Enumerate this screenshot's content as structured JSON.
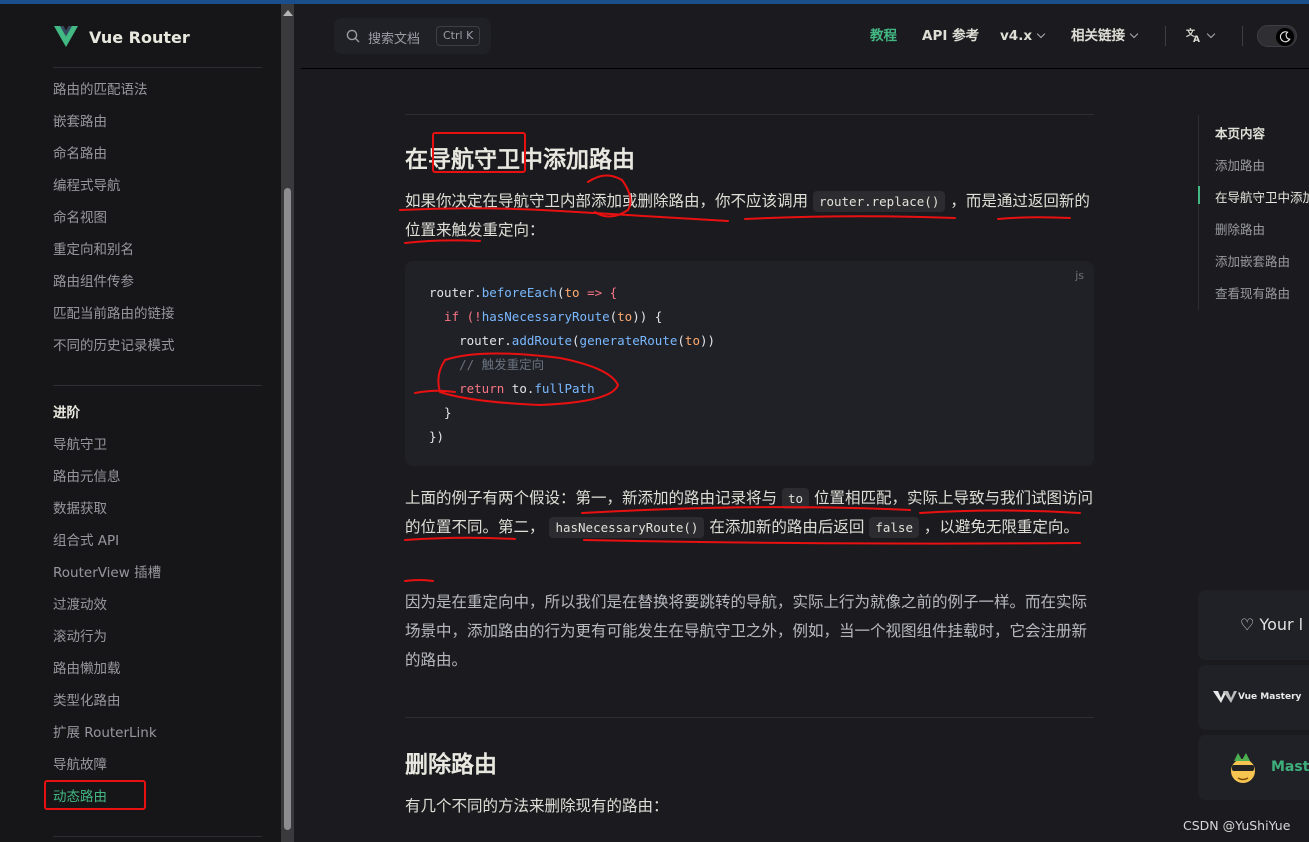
{
  "brand": {
    "title": "Vue Router"
  },
  "sidebar": {
    "items": [
      "路由的匹配语法",
      "嵌套路由",
      "命名路由",
      "编程式导航",
      "命名视图",
      "重定向和别名",
      "路由组件传参",
      "匹配当前路由的链接",
      "不同的历史记录模式"
    ],
    "advanced_heading": "进阶",
    "advanced_items": [
      "导航守卫",
      "路由元信息",
      "数据获取",
      "组合式 API",
      "RouterView 插槽",
      "过渡动效",
      "滚动行为",
      "路由懒加载",
      "类型化路由",
      "扩展 RouterLink",
      "导航故障",
      "动态路由"
    ]
  },
  "search": {
    "placeholder": "搜索文档",
    "shortcut": "Ctrl K"
  },
  "topnav": {
    "tutorial": "教程",
    "api": "API 参考",
    "version": "v4.x",
    "links": "相关链接",
    "lang_icon": "translate-icon"
  },
  "content": {
    "h2_add": "在导航守卫中添加路由",
    "p1_a": "如果你决定在导航守卫内部添加或删除路由，你不应该调用",
    "p1_code": "router.replace()",
    "p1_b": "，而是通过返回新的位置来触发重定向：",
    "code_lang": "js",
    "p2_a": "上面的例子有两个假设：第一，新添加的路由记录将与",
    "p2_code1": "to",
    "p2_b": "位置相匹配，实际上导致与我们试图访问的位置不同。第二，",
    "p2_code2": "hasNecessaryRoute()",
    "p2_c": "在添加新的路由后返回",
    "p2_code3": "false",
    "p2_d": "，以避免无限重定向。",
    "p3": "因为是在重定向中，所以我们是在替换将要跳转的导航，实际上行为就像之前的例子一样。而在实际场景中，添加路由的行为更有可能发生在导航守卫之外，例如，当一个视图组件挂载时，它会注册新的路由。",
    "h2_remove": "删除路由",
    "p4": "有几个不同的方法来删除现有的路由："
  },
  "code": {
    "l1": [
      "router",
      ".",
      "beforeEach",
      "(",
      "to",
      " => {"
    ],
    "l2": [
      "  if (!",
      "hasNecessaryRoute",
      "(",
      "to",
      ")) {"
    ],
    "l3": [
      "    ",
      "router",
      ".",
      "addRoute",
      "(",
      "generateRoute",
      "(",
      "to",
      "))"
    ],
    "l4": "    // 触发重定向",
    "l5": [
      "    return ",
      "to",
      ".",
      "fullPath"
    ],
    "l6": "  }",
    "l7": "})"
  },
  "toc": {
    "title": "本页内容",
    "items": [
      "添加路由",
      "在导航守卫中添加路由",
      "删除路由",
      "添加嵌套路由",
      "查看现有路由"
    ]
  },
  "sponsors": {
    "your": "♡ Your l",
    "vue_mastery": "Vue Mastery",
    "mastering": "Maste"
  },
  "footer": {
    "credit": "CSDN @YuShiYue"
  },
  "colors": {
    "accent": "#42b883",
    "annotation": "#e81010",
    "bg": "#1b1b1f",
    "sidebar_bg": "#161618"
  }
}
